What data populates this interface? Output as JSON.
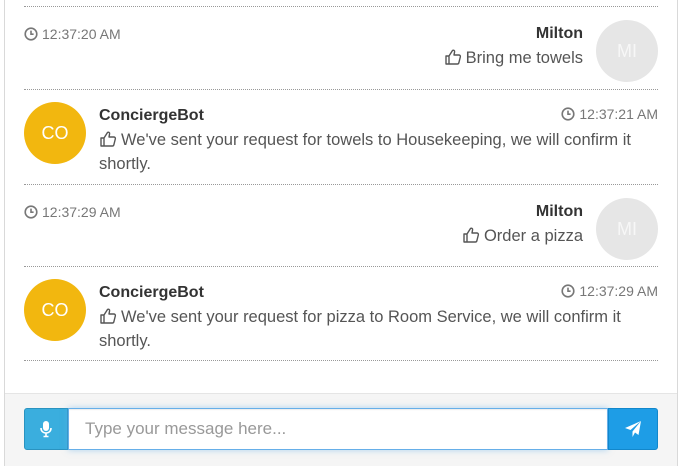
{
  "messages": [
    {
      "sender": "Milton",
      "initials": "MI",
      "time": "12:37:20 AM",
      "text": "Bring me towels",
      "role": "user"
    },
    {
      "sender": "ConciergeBot",
      "initials": "CO",
      "time": "12:37:21 AM",
      "text": "We've sent your request for towels to Housekeeping, we will confirm it shortly.",
      "role": "bot"
    },
    {
      "sender": "Milton",
      "initials": "MI",
      "time": "12:37:29 AM",
      "text": "Order a pizza",
      "role": "user"
    },
    {
      "sender": "ConciergeBot",
      "initials": "CO",
      "time": "12:37:29 AM",
      "text": "We've sent your request for pizza to Room Service, we will confirm it shortly.",
      "role": "bot"
    }
  ],
  "input": {
    "placeholder": "Type your message here..."
  },
  "colors": {
    "bot_avatar": "#f2b70f",
    "user_avatar": "#e6e6e6",
    "mic_button": "#3aaede",
    "send_button": "#1e9de6"
  },
  "icons": {
    "mic": "microphone-icon",
    "send": "paper-plane-icon",
    "time": "clock-icon",
    "like": "thumbs-up-icon"
  }
}
